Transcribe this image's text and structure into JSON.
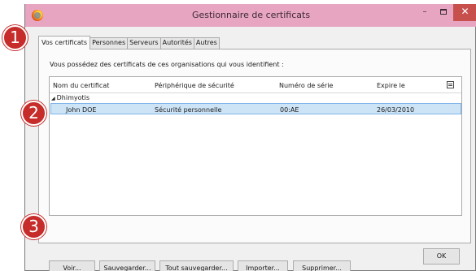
{
  "window": {
    "title": "Gestionnaire de certificats",
    "minimize_glyph": "–",
    "close_glyph": "✕"
  },
  "tabs": [
    {
      "label": "Vos certificats",
      "active": true
    },
    {
      "label": "Personnes",
      "active": false
    },
    {
      "label": "Serveurs",
      "active": false
    },
    {
      "label": "Autorités",
      "active": false
    },
    {
      "label": "Autres",
      "active": false
    }
  ],
  "panel": {
    "intro": "Vous possédez des certificats de ces organisations qui vous identifient :"
  },
  "table": {
    "columns": [
      "Nom du certificat",
      "Périphérique de sécurité",
      "Numéro de série",
      "Expire le"
    ],
    "group": {
      "twisty": "◢",
      "name": "Dhimyotis"
    },
    "rows": [
      {
        "name": "John DOE",
        "device": "Sécurité personnelle",
        "serial": "00:AE",
        "expires": "26/03/2010",
        "selected": true
      }
    ]
  },
  "buttons": {
    "view": "Voir...",
    "backup": "Sauvegarder...",
    "backup_all": "Tout sauvegarder...",
    "import": "Importer...",
    "delete": "Supprimer...",
    "ok": "OK"
  },
  "markers": [
    "1",
    "2",
    "3"
  ],
  "colors": {
    "titlebar": "#e8a5c2",
    "selection": "#cde4f7",
    "marker": "#c62c2a",
    "close_button": "#c7504d"
  }
}
